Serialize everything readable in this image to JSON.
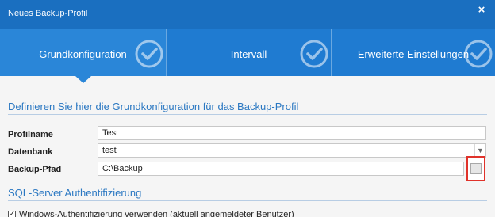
{
  "window": {
    "title": "Neues Backup-Profil",
    "close_symbol": "×"
  },
  "tabs": [
    {
      "label": "Grundkonfiguration",
      "active": true
    },
    {
      "label": "Intervall",
      "active": false
    },
    {
      "label": "Erweiterte Einstellungen",
      "active": false
    }
  ],
  "section1": {
    "title": "Definieren Sie hier die Grundkonfiguration für das Backup-Profil"
  },
  "form": {
    "profilname": {
      "label": "Profilname",
      "value": "Test"
    },
    "datenbank": {
      "label": "Datenbank",
      "value": "test"
    },
    "backup_pfad": {
      "label": "Backup-Pfad",
      "value": "C:\\Backup"
    }
  },
  "section2": {
    "title": "SQL-Server Authentifizierung"
  },
  "windows_auth": {
    "label": "Windows-Authentifizierung verwenden (aktuell angemeldeter Benutzer)",
    "checked": true
  },
  "colors": {
    "titlebar": "#1a6fc0",
    "tabbar": "#1f7bd1",
    "section_title": "#2b78c2",
    "highlight": "#e0322a"
  }
}
